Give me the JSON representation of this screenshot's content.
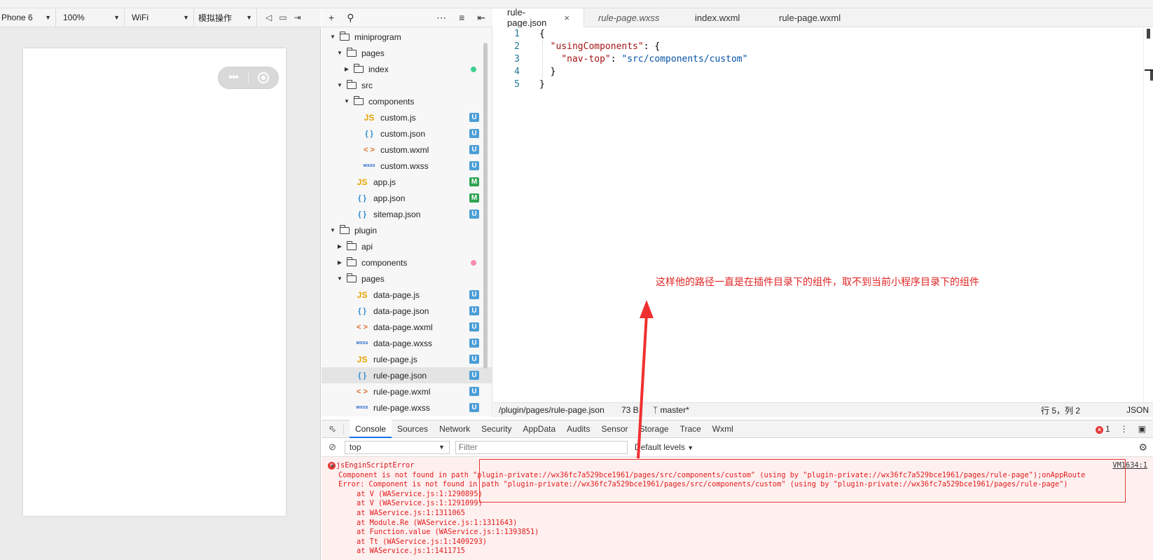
{
  "simulator": {
    "device": "Phone 6",
    "zoom": "100%",
    "network": "WiFi",
    "operation": "模拟操作",
    "capsule_dots": "•••"
  },
  "explorer": {
    "tree": [
      {
        "label": "miniprogram",
        "kind": "folder",
        "open": true,
        "depth": 0
      },
      {
        "label": "pages",
        "kind": "folder",
        "open": true,
        "depth": 1
      },
      {
        "label": "index",
        "kind": "folder",
        "open": false,
        "depth": 2,
        "dot": "#3ecf8e"
      },
      {
        "label": "src",
        "kind": "folder",
        "open": true,
        "depth": 1
      },
      {
        "label": "components",
        "kind": "folder",
        "open": true,
        "depth": 2
      },
      {
        "label": "custom.js",
        "kind": "js",
        "depth": 3,
        "badge": "U"
      },
      {
        "label": "custom.json",
        "kind": "json",
        "depth": 3,
        "badge": "U"
      },
      {
        "label": "custom.wxml",
        "kind": "wxml",
        "depth": 3,
        "badge": "U"
      },
      {
        "label": "custom.wxss",
        "kind": "wxss",
        "depth": 3,
        "badge": "U"
      },
      {
        "label": "app.js",
        "kind": "js",
        "depth": 2,
        "badge": "M"
      },
      {
        "label": "app.json",
        "kind": "json",
        "depth": 2,
        "badge": "M"
      },
      {
        "label": "sitemap.json",
        "kind": "json",
        "depth": 2,
        "badge": "U"
      },
      {
        "label": "plugin",
        "kind": "folder",
        "open": true,
        "depth": 0
      },
      {
        "label": "api",
        "kind": "folder",
        "open": false,
        "depth": 1
      },
      {
        "label": "components",
        "kind": "folder",
        "open": false,
        "depth": 1,
        "dot": "#f58cb0"
      },
      {
        "label": "pages",
        "kind": "folder",
        "open": true,
        "depth": 1
      },
      {
        "label": "data-page.js",
        "kind": "js",
        "depth": 2,
        "badge": "U"
      },
      {
        "label": "data-page.json",
        "kind": "json",
        "depth": 2,
        "badge": "U"
      },
      {
        "label": "data-page.wxml",
        "kind": "wxml",
        "depth": 2,
        "badge": "U"
      },
      {
        "label": "data-page.wxss",
        "kind": "wxss",
        "depth": 2,
        "badge": "U"
      },
      {
        "label": "rule-page.js",
        "kind": "js",
        "depth": 2,
        "badge": "U"
      },
      {
        "label": "rule-page.json",
        "kind": "json",
        "depth": 2,
        "badge": "U",
        "selected": true
      },
      {
        "label": "rule-page.wxml",
        "kind": "wxml",
        "depth": 2,
        "badge": "U"
      },
      {
        "label": "rule-page.wxss",
        "kind": "wxss",
        "depth": 2,
        "badge": "U"
      }
    ],
    "icon_glyphs": {
      "js": "JS",
      "json": "{ }",
      "wxml": "< >",
      "wxss": "wxss"
    }
  },
  "editor": {
    "tabs": [
      {
        "label": "rule-page.json",
        "active": true,
        "italic": false
      },
      {
        "label": "rule-page.wxss",
        "active": false,
        "italic": true
      },
      {
        "label": "index.wxml",
        "active": false,
        "italic": false
      },
      {
        "label": "rule-page.wxml",
        "active": false,
        "italic": false
      }
    ],
    "tab_close": "×",
    "lines": [
      {
        "n": "1",
        "parts": [
          [
            "p",
            "{"
          ]
        ]
      },
      {
        "n": "2",
        "parts": [
          [
            "p",
            "  "
          ],
          [
            "k",
            "\"usingComponents\""
          ],
          [
            "p",
            ": {"
          ]
        ]
      },
      {
        "n": "3",
        "parts": [
          [
            "p",
            "    "
          ],
          [
            "k",
            "\"nav-top\""
          ],
          [
            "p",
            ": "
          ],
          [
            "s",
            "\"src/components/custom\""
          ]
        ]
      },
      {
        "n": "4",
        "parts": [
          [
            "p",
            "  }"
          ]
        ]
      },
      {
        "n": "5",
        "parts": [
          [
            "p",
            "}"
          ]
        ]
      }
    ],
    "annotation": "这样他的路径一直是在插件目录下的组件，取不到当前小程序目录下的组件",
    "annotation_color": "#e02424"
  },
  "statusbar": {
    "path": "/plugin/pages/rule-page.json",
    "size": "73 B",
    "branch": "master*",
    "position": "行 5，列 2",
    "language": "JSON"
  },
  "devtools": {
    "tabs": [
      "Console",
      "Sources",
      "Network",
      "Security",
      "AppData",
      "Audits",
      "Sensor",
      "Storage",
      "Trace",
      "Wxml"
    ],
    "active_tab": "Console",
    "error_count": "1",
    "context": "top",
    "filter_placeholder": "Filter",
    "levels": "Default levels",
    "vm_link": "VM1634:1",
    "console": [
      {
        "text": "jsEnginScriptError",
        "cls": "head",
        "indent": 0
      },
      {
        "text": "Component is not found in path \"plugin-private://wx36fc7a529bce1961/pages/src/components/custom\" (using by \"plugin-private://wx36fc7a529bce1961/pages/rule-page\");onAppRoute",
        "indent": 0
      },
      {
        "text": "Error: Component is not found in path \"plugin-private://wx36fc7a529bce1961/pages/src/components/custom\" (using by \"plugin-private://wx36fc7a529bce1961/pages/rule-page\")",
        "indent": 0
      },
      {
        "text": "at V (WAService.js:1:1290895)",
        "indent": 1
      },
      {
        "text": "at V (WAService.js:1:1291099)",
        "indent": 1
      },
      {
        "text": "at WAService.js:1:1311065",
        "indent": 1
      },
      {
        "text": "at Module.Re (WAService.js:1:1311643)",
        "indent": 1
      },
      {
        "text": "at Function.value (WAService.js:1:1393851)",
        "indent": 1
      },
      {
        "text": "at Tt (WAService.js:1:1409293)",
        "indent": 1
      },
      {
        "text": "at WAService.js:1:1411715",
        "indent": 1
      }
    ]
  }
}
